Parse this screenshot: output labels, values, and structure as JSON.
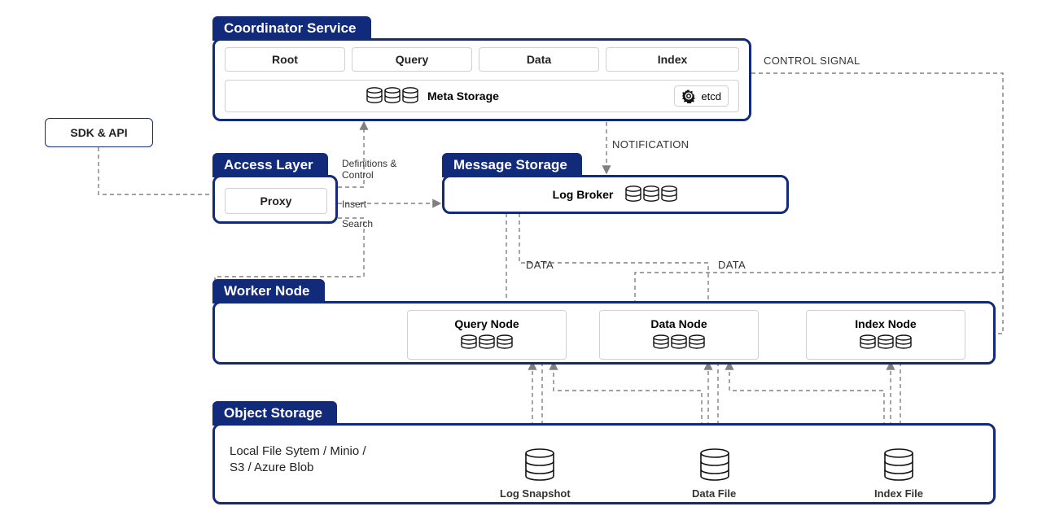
{
  "sdk": {
    "label": "SDK & API"
  },
  "coordinator": {
    "title": "Coordinator Service",
    "tabs": [
      "Root",
      "Query",
      "Data",
      "Index"
    ],
    "meta_label": "Meta Storage",
    "etcd_label": "etcd"
  },
  "access": {
    "title": "Access Layer",
    "proxy_label": "Proxy"
  },
  "message": {
    "title": "Message Storage",
    "broker_label": "Log Broker"
  },
  "worker": {
    "title": "Worker Node",
    "nodes": [
      {
        "label": "Query Node"
      },
      {
        "label": "Data Node"
      },
      {
        "label": "Index Node"
      }
    ]
  },
  "object": {
    "title": "Object Storage",
    "desc1": "Local File Sytem / Minio /",
    "desc2": "S3 / Azure Blob",
    "files": [
      {
        "label": "Log Snapshot"
      },
      {
        "label": "Data File"
      },
      {
        "label": "Index File"
      }
    ]
  },
  "labels": {
    "control_signal": "CONTROL SIGNAL",
    "notification": "NOTIFICATION",
    "definitions": "Definitions &",
    "control": "Control",
    "insert": "Insert",
    "search": "Search",
    "data1": "DATA",
    "data2": "DATA"
  },
  "colors": {
    "brand": "#112a79",
    "arrow": "#808080"
  }
}
